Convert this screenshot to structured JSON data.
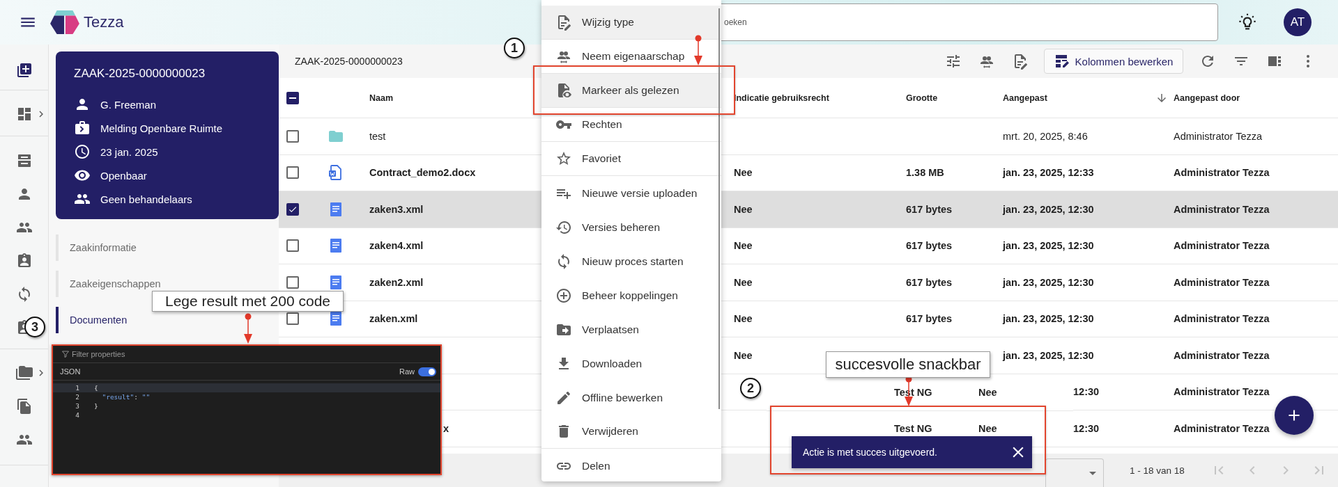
{
  "header": {
    "app_name": "Tezza",
    "search": {
      "placeholder": "oeken"
    },
    "avatar": "AT"
  },
  "case_card": {
    "title": "ZAAK-2025-0000000023",
    "details": [
      "G. Freeman",
      "Melding Openbare Ruimte",
      "23 jan. 2025",
      "Openbaar",
      "Geen behandelaars"
    ]
  },
  "case_nav": [
    {
      "label": "Zaakinformatie",
      "selected": false
    },
    {
      "label": "Zaakeigenschappen",
      "selected": false
    },
    {
      "label": "Documenten",
      "selected": true
    }
  ],
  "toolbar": {
    "title": "ZAAK-2025-0000000023",
    "button": "Kolommen bewerken"
  },
  "table": {
    "select_all_indeterminate": true,
    "columns": [
      {
        "label": "Naam"
      },
      {
        "label": "Indicatie gebruiksrecht"
      },
      {
        "label": "Grootte"
      },
      {
        "label": "Aangepast",
        "sorted": true
      },
      {
        "label": "Aangepast door"
      }
    ],
    "rows": [
      {
        "kind": "folder",
        "name": "test",
        "selected": false,
        "unread": false,
        "modified": "mrt. 20, 2025, 8:46",
        "modified_by": "Administrator Tezza"
      },
      {
        "kind": "word",
        "name": "Contract_demo2.docx",
        "selected": false,
        "unread": true,
        "rights": "Nee",
        "size": "1.38 MB",
        "modified": "jan. 23, 2025, 12:33",
        "modified_by": "Administrator Tezza"
      },
      {
        "kind": "xml",
        "name": "zaken3.xml",
        "selected": true,
        "unread": true,
        "rights": "Nee",
        "size": "617 bytes",
        "modified": "jan. 23, 2025, 12:30",
        "modified_by": "Administrator Tezza"
      },
      {
        "kind": "xml",
        "name": "zaken4.xml",
        "selected": false,
        "unread": true,
        "rights": "Nee",
        "size": "617 bytes",
        "modified": "jan. 23, 2025, 12:30",
        "modified_by": "Administrator Tezza"
      },
      {
        "kind": "xml",
        "name": "zaken2.xml",
        "selected": false,
        "unread": true,
        "rights": "Nee",
        "size": "617 bytes",
        "modified": "jan. 23, 2025, 12:30",
        "modified_by": "Administrator Tezza"
      },
      {
        "kind": "xml",
        "name": "zaken.xml",
        "selected": false,
        "unread": true,
        "rights": "Nee",
        "size": "617 bytes",
        "modified": "jan. 23, 2025, 12:30",
        "modified_by": "Administrator Tezza"
      },
      {
        "kind": "covered",
        "unread": true,
        "rights": "Nee",
        "modified": "jan. 23, 2025, 12:30",
        "modified_by": "Administrator Tezza"
      },
      {
        "kind": "covered_tail",
        "unread": true,
        "modified": "12:30",
        "modified_by": "Administrator Tezza"
      },
      {
        "kind": "covered_tail",
        "unread": true,
        "name": "x",
        "modified": "12:30",
        "modified_by": "Administrator Tezza"
      }
    ]
  },
  "paginator": {
    "range": "1 - 18 van 18"
  },
  "context_menu": {
    "items": [
      {
        "label": "Wijzig type",
        "highlighted": true
      },
      {
        "label": "Neem eigenaarschap",
        "highlighted": false
      },
      {
        "label": "Markeer als gelezen",
        "highlighted": true
      },
      {
        "label": "Rechten",
        "highlighted": false
      },
      {
        "label": "Favoriet",
        "highlighted": false
      },
      {
        "label": "Nieuwe versie uploaden",
        "highlighted": false
      },
      {
        "label": "Versies beheren",
        "highlighted": false
      },
      {
        "label": "Nieuw proces starten",
        "highlighted": false
      },
      {
        "label": "Beheer koppelingen",
        "highlighted": false
      },
      {
        "label": "Verplaatsen",
        "highlighted": false
      },
      {
        "label": "Downloaden",
        "highlighted": false
      },
      {
        "label": "Offline bewerken",
        "highlighted": false
      },
      {
        "label": "Verwijderen",
        "highlighted": false
      },
      {
        "label": "Delen",
        "highlighted": false
      }
    ]
  },
  "json_viewer": {
    "filter_placeholder": "Filter properties",
    "tab": "JSON",
    "raw_label": "Raw",
    "raw_on": true,
    "lines": [
      {
        "number": "1",
        "highlighted": true,
        "tokens": [
          {
            "kind": "punct",
            "text": "{"
          }
        ]
      },
      {
        "number": "2",
        "highlighted": false,
        "tokens": [
          {
            "kind": "key",
            "text": "  \"result\""
          },
          {
            "kind": "punct",
            "text": ": "
          },
          {
            "kind": "string",
            "text": "\"\""
          }
        ]
      },
      {
        "number": "3",
        "highlighted": false,
        "tokens": [
          {
            "kind": "punct",
            "text": "}"
          }
        ]
      },
      {
        "number": "4",
        "highlighted": false
      }
    ]
  },
  "snackbar_capture": {
    "rows": [
      {
        "column_1": "Test NG",
        "column_2": "Nee"
      },
      {
        "column_1": "Test NG",
        "column_2": "Nee"
      }
    ],
    "snackbar": {
      "message": "Actie is met succes uitgevoerd."
    }
  },
  "annotations": [
    {
      "kind": "badge",
      "text": "1"
    },
    {
      "kind": "badge",
      "text": "2"
    },
    {
      "kind": "badge",
      "text": "3"
    },
    {
      "kind": "callout",
      "text": "Lege result met 200 code"
    },
    {
      "kind": "callout",
      "text": "succesvolle snackbar"
    }
  ]
}
